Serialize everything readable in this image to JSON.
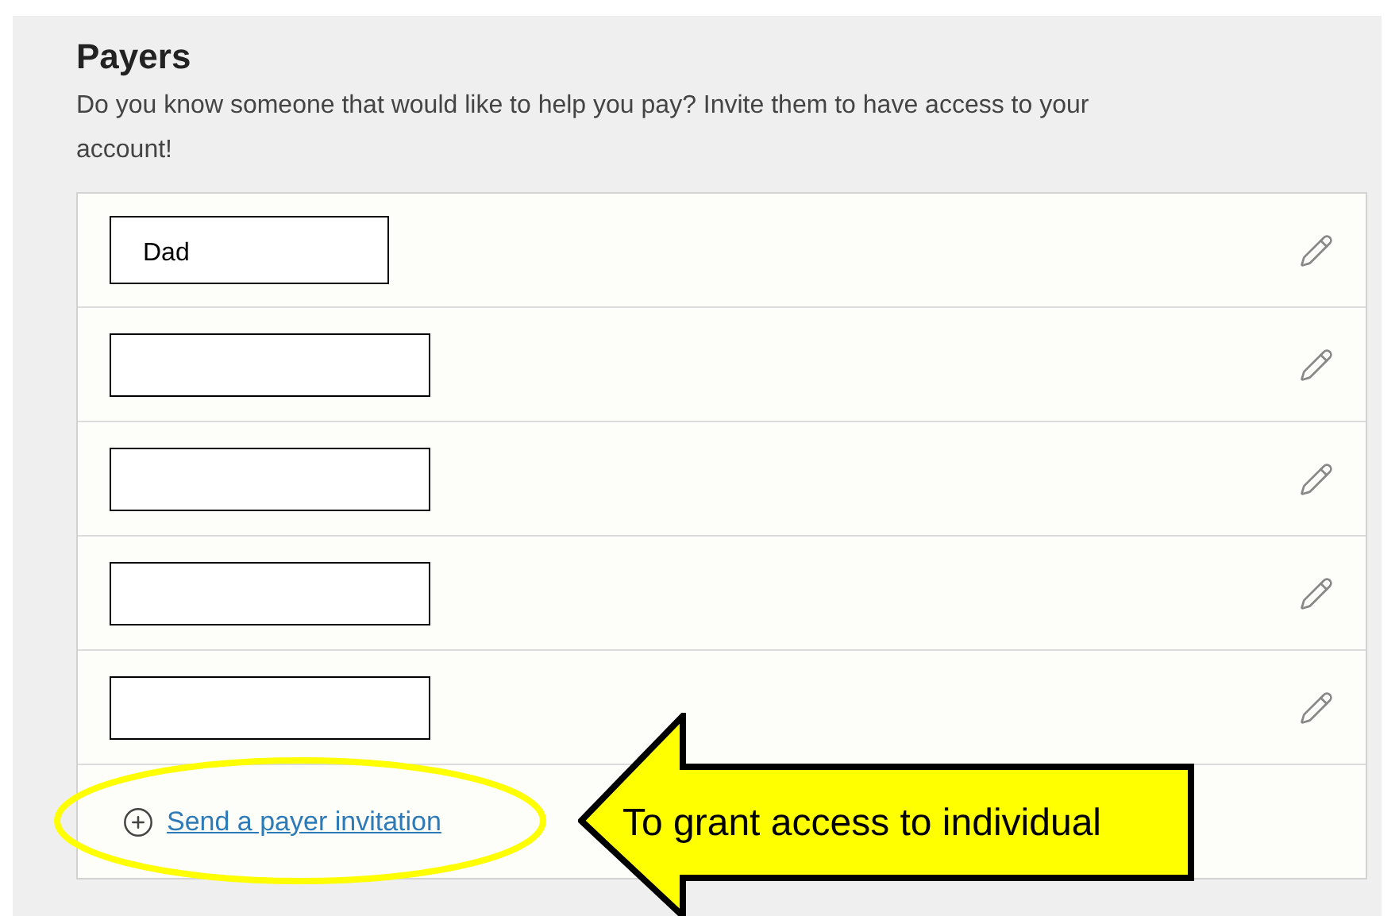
{
  "section": {
    "title": "Payers",
    "description": "Do you know someone that would like to help you pay? Invite them to have access to your account!"
  },
  "payers": [
    {
      "kind": "labeled",
      "name": "Dad"
    },
    {
      "kind": "redacted"
    },
    {
      "kind": "redacted"
    },
    {
      "kind": "redacted"
    },
    {
      "kind": "redacted"
    }
  ],
  "invite_link": "Send a payer invitation",
  "callout": {
    "text": "To grant access to individual"
  }
}
